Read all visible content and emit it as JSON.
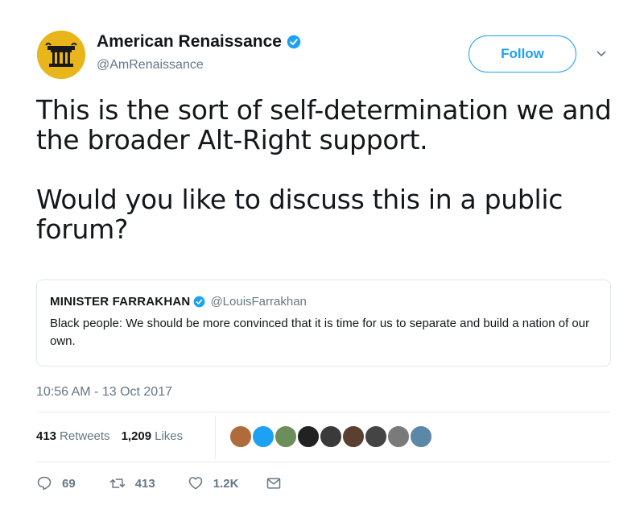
{
  "author": {
    "display_name": "American Renaissance",
    "handle": "@AmRenaissance",
    "verified": true,
    "avatar_color": "#e8b51a"
  },
  "follow_button": {
    "label": "Follow"
  },
  "tweet": {
    "paragraphs": [
      "This is the sort of self-determination we and the broader Alt-Right support.",
      "Would you like to discuss this in a public forum?"
    ]
  },
  "quoted_tweet": {
    "display_name": "MINISTER FARRAKHAN",
    "handle": "@LouisFarrakhan",
    "verified": true,
    "text": "Black people: We should be more convinced that it is time for us to separate and build a nation of our own."
  },
  "timestamp": "10:56 AM - 13 Oct 2017",
  "stats": {
    "retweets_count": "413",
    "retweets_label": "Retweets",
    "likes_count": "1,209",
    "likes_label": "Likes"
  },
  "likers": [
    {
      "color": "#b06b3a"
    },
    {
      "color": "#1da1f2"
    },
    {
      "color": "#6b8e5a"
    },
    {
      "color": "#222222"
    },
    {
      "color": "#3a3a3a"
    },
    {
      "color": "#5a4030"
    },
    {
      "color": "#444444"
    },
    {
      "color": "#7a7a7a"
    },
    {
      "color": "#5b87a8"
    }
  ],
  "actions": {
    "reply_count": "69",
    "retweet_count": "413",
    "like_count": "1.2K"
  },
  "colors": {
    "accent": "#1da1f2",
    "secondary_text": "#657786"
  }
}
